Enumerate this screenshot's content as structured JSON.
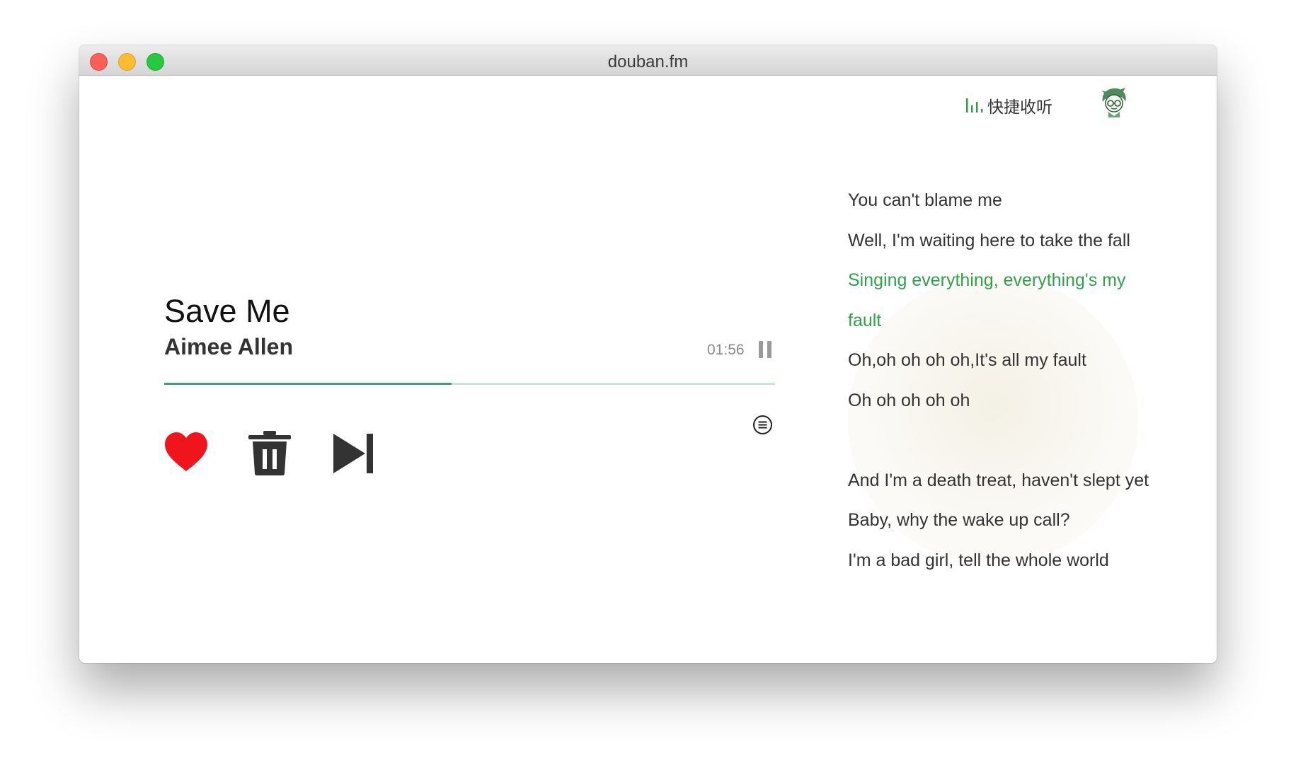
{
  "window": {
    "title": "douban.fm"
  },
  "topbar": {
    "quick_listen_label": "快捷收听",
    "quick_listen_icon": "equalizer-bars-icon",
    "avatar_icon": "user-avatar-icon"
  },
  "player": {
    "song_title": "Save Me",
    "artist": "Aimee Allen",
    "time_remaining": "01:56",
    "progress": 0.47,
    "controls": {
      "like_icon": "heart-icon",
      "delete_icon": "trash-icon",
      "skip_icon": "skip-next-icon",
      "pause_icon": "pause-icon",
      "lyrics_icon": "lyrics-menu-icon"
    }
  },
  "lyrics": {
    "lines": [
      "You can't blame me",
      "Well, I'm waiting here to take the fall",
      "Singing everything, everything's my",
      "fault",
      "Oh,oh oh oh oh,It's all my fault",
      "Oh oh oh oh oh",
      "",
      "And I'm a death treat, haven't slept yet",
      "Baby, why the wake up call?",
      "I'm a bad girl, tell the whole world"
    ],
    "active_lines": [
      2,
      3
    ]
  },
  "colors": {
    "accent_green": "#31a14c",
    "progress_green": "#3ea36b",
    "like_red": "#f0151c",
    "icon_dark": "#333333"
  }
}
